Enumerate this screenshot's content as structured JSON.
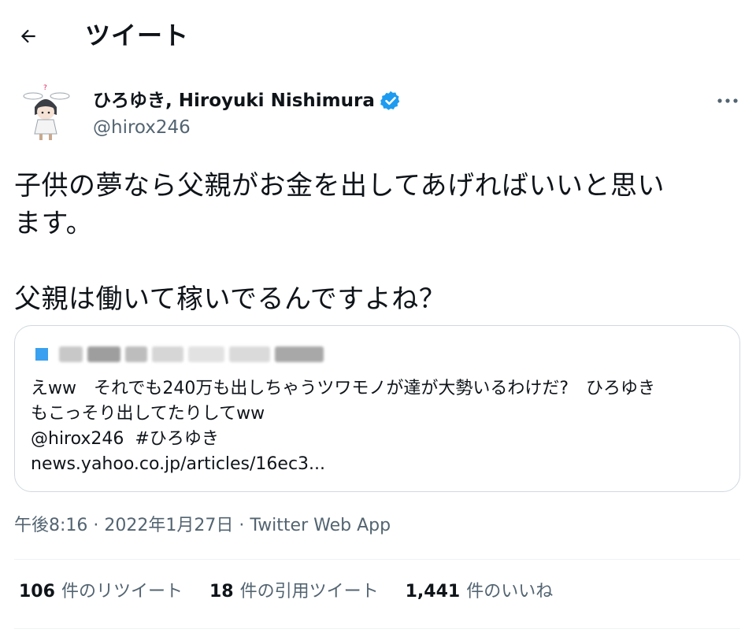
{
  "header": {
    "title": "ツイート"
  },
  "author": {
    "name": "ひろゆき, Hiroyuki Nishimura",
    "handle": "@hirox246",
    "verified_color": "#1d9bf0"
  },
  "tweet": {
    "lines": [
      "子供の夢なら父親がお金を出してあげればいいと思い",
      "ます。",
      "",
      "父親は働いて稼いでるんですよね？"
    ]
  },
  "quote": {
    "text_line1": "えww　それでも240万も出しちゃうツワモノが達が大勢いるわけだ?　ひろゆき",
    "text_line2": "もこっそり出してたりしてww",
    "mention": "@hirox246",
    "hashtag": "#ひろゆき",
    "link": "news.yahoo.co.jp/articles/16ec3..."
  },
  "meta": {
    "time": "午後8:16",
    "date": "2022年1月27日",
    "source": "Twitter Web App",
    "sep": "·"
  },
  "stats": {
    "retweets_count": "106",
    "retweets_label": "件のリツイート",
    "quotes_count": "18",
    "quotes_label": "件の引用ツイート",
    "likes_count": "1,441",
    "likes_label": "件のいいね"
  }
}
